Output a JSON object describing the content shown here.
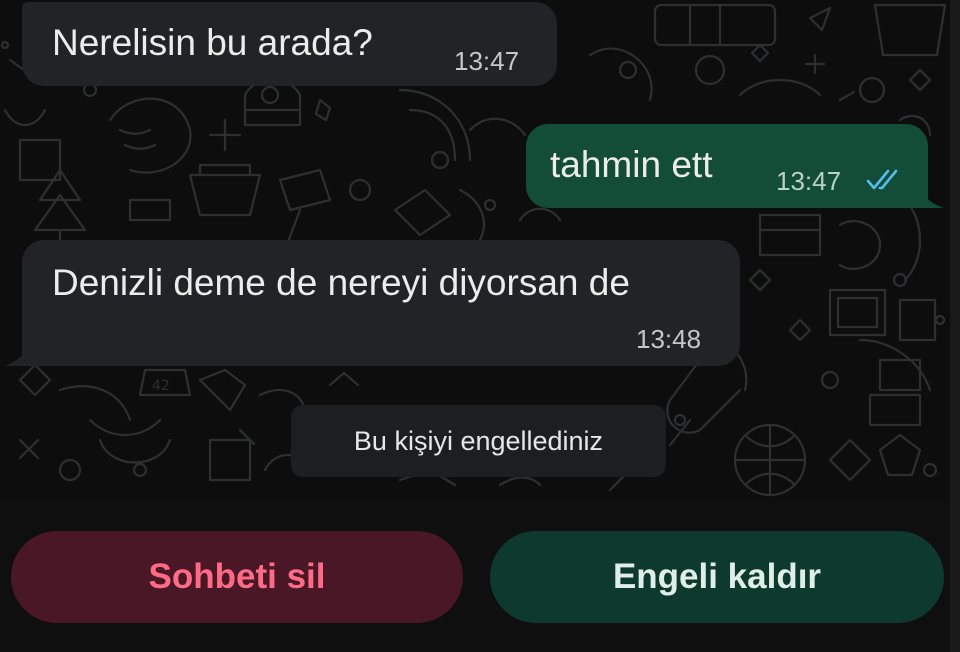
{
  "messages": [
    {
      "direction": "incoming",
      "text": "Nerelisin bu arada?",
      "time": "13:47"
    },
    {
      "direction": "outgoing",
      "text": "tahmin ett",
      "time": "13:47",
      "status": "read"
    },
    {
      "direction": "incoming",
      "text": "Denizli deme de nereyi diyorsan de",
      "time": "13:48"
    }
  ],
  "system_notice": "Bu kişiyi engellediniz",
  "actions": {
    "delete_chat_label": "Sohbeti sil",
    "unblock_label": "Engeli kaldır"
  },
  "colors": {
    "incoming_bubble": "#222327",
    "outgoing_bubble": "#144d37",
    "read_ticks": "#53bdeb",
    "delete_text": "#ff6b86",
    "delete_bg": "#4a1726",
    "unblock_bg": "#0e3a2e"
  },
  "icons": {
    "read_receipt": "double-check-icon"
  }
}
